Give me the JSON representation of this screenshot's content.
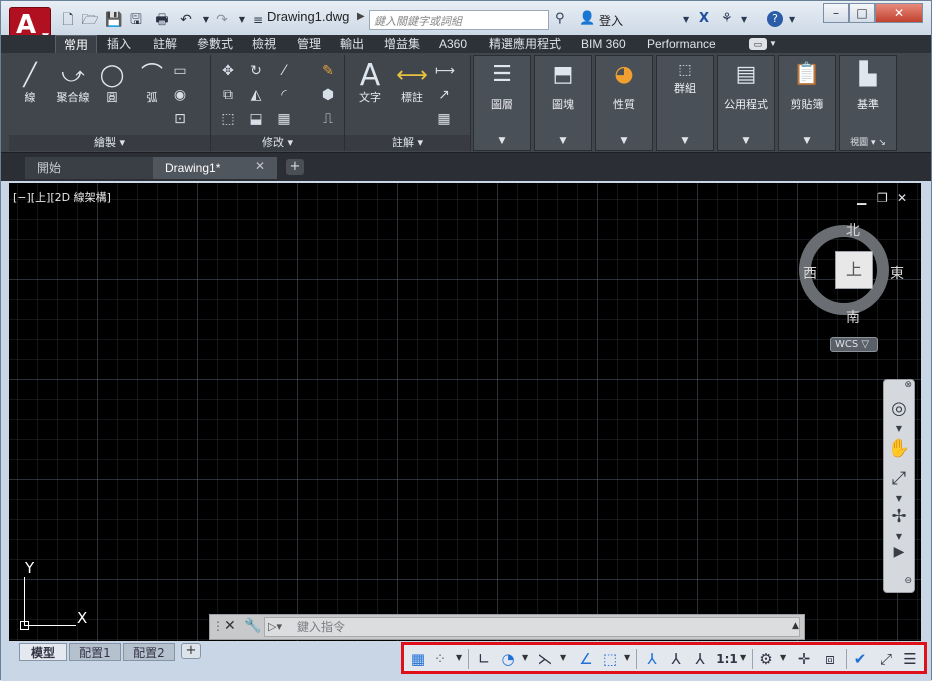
{
  "window": {
    "document_title": "Drawing1.dwg",
    "search_placeholder": "鍵入關鍵字或詞組",
    "login_label": "登入"
  },
  "ribbon_tabs": [
    "常用",
    "插入",
    "註解",
    "參數式",
    "檢視",
    "管理",
    "輸出",
    "增益集",
    "A360",
    "精選應用程式",
    "BIM 360",
    "Performance"
  ],
  "ribbon": {
    "draw": {
      "line": "線",
      "polyline": "聚合線",
      "circle": "圓",
      "arc": "弧",
      "footer": "繪製"
    },
    "modify": {
      "footer": "修改"
    },
    "annotation": {
      "text": "文字",
      "dimension": "標註",
      "footer": "註解"
    },
    "layers": "圖層",
    "block": "圖塊",
    "properties": "性質",
    "groups": "群組",
    "utilities": "公用程式",
    "clipboard": "剪貼簿",
    "view": {
      "base": "基準",
      "footer": "視圖"
    }
  },
  "doc_tabs": {
    "start": "開始",
    "drawing": "Drawing1*"
  },
  "viewport": {
    "label": "[−][上][2D 線架構]"
  },
  "viewcube": {
    "north": "北",
    "south": "南",
    "east": "東",
    "west": "西",
    "face": "上",
    "wcs": "WCS"
  },
  "ucs": {
    "x": "X",
    "y": "Y"
  },
  "command": {
    "placeholder": "鍵入指令"
  },
  "layout_tabs": [
    "模型",
    "配置1",
    "配置2"
  ],
  "status": {
    "scale": "1:1"
  },
  "colors": {
    "highlight_border": "#e0101a",
    "accent": "#1f6fd6",
    "app_red": "#b01020"
  }
}
